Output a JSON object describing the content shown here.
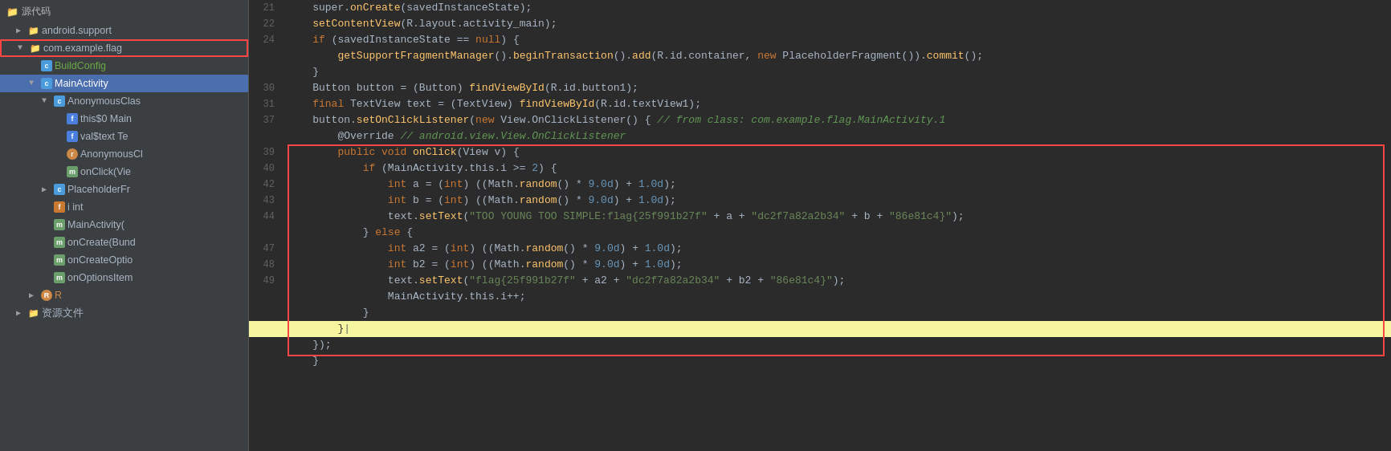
{
  "sidebar": {
    "title": "源代码",
    "items": [
      {
        "id": "android-support",
        "label": "android.support",
        "indent": 1,
        "type": "folder",
        "arrow": "closed"
      },
      {
        "id": "com-example-flag",
        "label": "com.example.flag",
        "indent": 1,
        "type": "folder",
        "arrow": "open",
        "highlighted": true
      },
      {
        "id": "BuildConfig",
        "label": "BuildConfig",
        "indent": 2,
        "type": "class-c",
        "arrow": "empty"
      },
      {
        "id": "MainActivity",
        "label": "MainActivity",
        "indent": 2,
        "type": "class-c",
        "arrow": "open",
        "selected": true
      },
      {
        "id": "AnonymousClas",
        "label": "AnonymousClas",
        "indent": 3,
        "type": "class-c",
        "arrow": "open"
      },
      {
        "id": "this0",
        "label": "this$0 Main",
        "indent": 4,
        "type": "class-f"
      },
      {
        "id": "val$text",
        "label": "val$text Te",
        "indent": 4,
        "type": "class-f"
      },
      {
        "id": "AnonymousCl",
        "label": "AnonymousCl",
        "indent": 4,
        "type": "class-r"
      },
      {
        "id": "onClick",
        "label": "onClick(Vie",
        "indent": 4,
        "type": "class-m"
      },
      {
        "id": "PlaceholderFr",
        "label": "PlaceholderFr",
        "indent": 3,
        "type": "class-c",
        "arrow": "closed"
      },
      {
        "id": "field-i",
        "label": "i int",
        "indent": 3,
        "type": "class-i"
      },
      {
        "id": "MainActivity2",
        "label": "MainActivity(",
        "indent": 3,
        "type": "class-m"
      },
      {
        "id": "onCreate",
        "label": "onCreate(Bund",
        "indent": 3,
        "type": "class-m"
      },
      {
        "id": "onCreateOptio",
        "label": "onCreateOptio",
        "indent": 3,
        "type": "class-m"
      },
      {
        "id": "onOptionsItem",
        "label": "onOptionsItem",
        "indent": 3,
        "type": "class-m"
      },
      {
        "id": "R",
        "label": "R",
        "indent": 2,
        "type": "class-r",
        "arrow": "closed"
      },
      {
        "id": "resources",
        "label": "资源文件",
        "indent": 1,
        "type": "folder",
        "arrow": "closed"
      }
    ]
  },
  "code": {
    "lines": [
      {
        "num": 21,
        "content": "    super.onCreate(savedInstanceState);",
        "style": "normal"
      },
      {
        "num": 22,
        "content": "    setContentView(R.layout.activity_main);",
        "style": "normal"
      },
      {
        "num": 24,
        "content": "    if (savedInstanceState == null) {",
        "style": "normal"
      },
      {
        "num": "",
        "content": "        getSupportFragmentManager().beginTransaction().add(R.id.container, new PlaceholderFragment()).commit();",
        "style": "normal"
      },
      {
        "num": "",
        "content": "    }",
        "style": "normal"
      },
      {
        "num": 30,
        "content": "    Button button = (Button) findViewById(R.id.button1);",
        "style": "normal"
      },
      {
        "num": 31,
        "content": "    final TextView text = (TextView) findViewById(R.id.textView1);",
        "style": "normal"
      },
      {
        "num": 37,
        "content": "    button.setOnClickListener(new View.OnClickListener() { // from class: com.example.flag.MainActivity.1",
        "style": "normal"
      },
      {
        "num": "",
        "content": "        @Override // android.view.View.OnClickListener",
        "style": "comment"
      },
      {
        "num": 39,
        "content": "        public void onClick(View v) {",
        "style": "normal"
      },
      {
        "num": 40,
        "content": "            if (MainActivity.this.i >= 2) {",
        "style": "redbox-start"
      },
      {
        "num": 42,
        "content": "                int a = (int) ((Math.random() * 9.0d) + 1.0d);",
        "style": "redbox"
      },
      {
        "num": 43,
        "content": "                int b = (int) ((Math.random() * 9.0d) + 1.0d);",
        "style": "redbox"
      },
      {
        "num": 44,
        "content": "                text.setText(\"TOO YOUNG TOO SIMPLE:flag{25f991b27f\" + a + \"dc2f7a82a2b34\" + b + \"86e81c4}\");",
        "style": "redbox"
      },
      {
        "num": "",
        "content": "            } else {",
        "style": "redbox"
      },
      {
        "num": 47,
        "content": "                int a2 = (int) ((Math.random() * 9.0d) + 1.0d);",
        "style": "redbox"
      },
      {
        "num": 48,
        "content": "                int b2 = (int) ((Math.random() * 9.0d) + 1.0d);",
        "style": "redbox"
      },
      {
        "num": 49,
        "content": "                text.setText(\"flag{25f991b27f\" + a2 + \"dc2f7a82a2b34\" + b2 + \"86e81c4}\");",
        "style": "redbox"
      },
      {
        "num": "",
        "content": "                MainActivity.this.i++;",
        "style": "redbox"
      },
      {
        "num": "",
        "content": "            }",
        "style": "redbox-end"
      },
      {
        "num": "",
        "content": "        }",
        "style": "yellow"
      },
      {
        "num": "",
        "content": "    });",
        "style": "normal"
      },
      {
        "num": "",
        "content": "}",
        "style": "normal"
      }
    ]
  }
}
